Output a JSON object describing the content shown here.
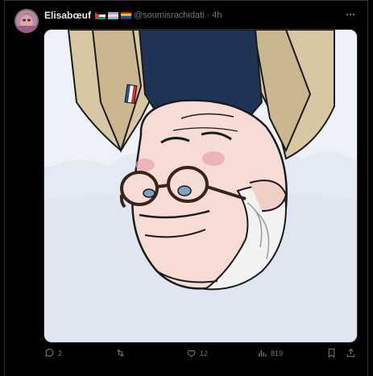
{
  "author": {
    "display_name": "Elisabœuf",
    "handle": "@soumisrachidati",
    "separator": "·",
    "time": "4h",
    "flag_icons": [
      "palestine-flag-icon",
      "transgender-flag-icon",
      "rainbow-flag-icon"
    ]
  },
  "media": {
    "icon": "cartoon-portrait-upside-down"
  },
  "actions": {
    "reply_count": "2",
    "retweet_count": "",
    "like_count": "12",
    "view_count": "819"
  },
  "colors": {
    "background": "#000000",
    "secondary_text": "#71767b",
    "primary_text": "#e7e9ea",
    "border": "#2f3336"
  }
}
